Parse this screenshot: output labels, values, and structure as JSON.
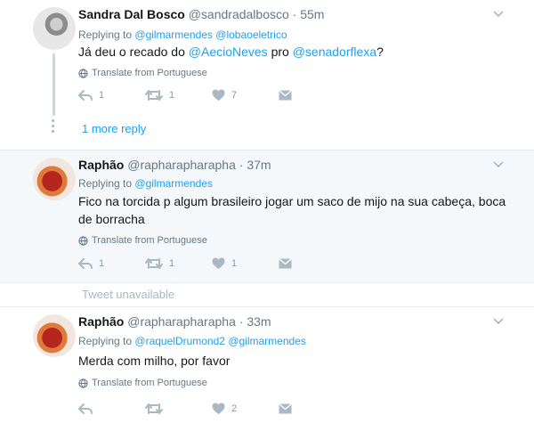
{
  "tweets": [
    {
      "name": "Sandra Dal Bosco",
      "handle": "@sandradalbosco",
      "sep": "·",
      "time": "55m",
      "replying_prefix": "Replying to",
      "replying_mentions": [
        "@gilmarmendes",
        "@lobaoeletrico"
      ],
      "text_parts": [
        "Já deu o recado do ",
        "@AecioNeves",
        " pro ",
        "@senadorflexa",
        "?"
      ],
      "translate": "Translate from Portuguese",
      "counts": {
        "reply": "1",
        "retweet": "1",
        "like": "7"
      }
    },
    {
      "name": "Raphão",
      "handle": "@rapharapharapha",
      "sep": "·",
      "time": "37m",
      "replying_prefix": "Replying to",
      "replying_mentions": [
        "@gilmarmendes"
      ],
      "text": "Fico na torcida p algum brasileiro jogar um saco de mijo na sua cabeça, boca de borracha",
      "translate": "Translate from Portuguese",
      "counts": {
        "reply": "1",
        "retweet": "1",
        "like": "1"
      }
    },
    {
      "name": "Raphão",
      "handle": "@rapharapharapha",
      "sep": "·",
      "time": "33m",
      "replying_prefix": "Replying to",
      "replying_mentions": [
        "@raquelDrumond2",
        "@gilmarmendes"
      ],
      "text": "Merda com milho, por favor",
      "translate": "Translate from Portuguese",
      "counts": {
        "reply": "",
        "retweet": "",
        "like": "2"
      }
    }
  ],
  "more_reply": "1 more reply",
  "tweet_unavailable": "Tweet unavailable",
  "colors": {
    "link": "#1da1f2",
    "muted": "#657786",
    "icon": "#aab8c2",
    "alt_bg": "#f5f8fa"
  }
}
